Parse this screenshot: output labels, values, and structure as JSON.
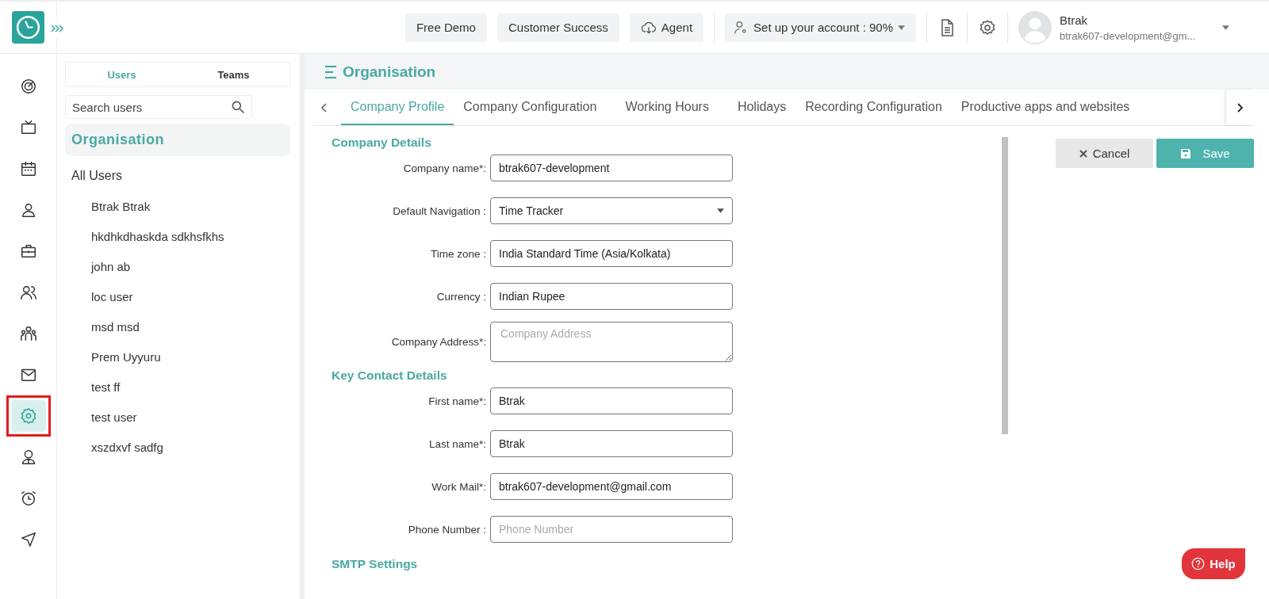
{
  "topbar": {
    "buttons": [
      {
        "label": "Free Demo",
        "kind": "plain"
      },
      {
        "label": "Customer Success",
        "kind": "plain"
      },
      {
        "label": "Agent",
        "kind": "download"
      }
    ],
    "setup": {
      "label": "Set up your account : 90%"
    },
    "user": {
      "name": "Btrak",
      "email": "btrak607-development@gm..."
    }
  },
  "rail": [
    {
      "kind": "target",
      "selected": false
    },
    {
      "kind": "tv",
      "selected": false
    },
    {
      "kind": "calendar",
      "selected": false
    },
    {
      "kind": "person",
      "selected": false
    },
    {
      "kind": "briefcase",
      "selected": false
    },
    {
      "kind": "people",
      "selected": false
    },
    {
      "kind": "group",
      "selected": false
    },
    {
      "kind": "mail",
      "selected": false
    },
    {
      "kind": "gear",
      "selected": true
    },
    {
      "kind": "badge",
      "selected": false
    },
    {
      "kind": "alarm",
      "selected": false
    },
    {
      "kind": "send",
      "selected": false
    }
  ],
  "users_panel": {
    "tabs": [
      {
        "label": "Users",
        "selected": true
      },
      {
        "label": "Teams",
        "selected": false
      }
    ],
    "search": {
      "placeholder": "Search users"
    },
    "tree": [
      {
        "label": "Organisation",
        "selected": true
      },
      {
        "label": "All Users",
        "selected": false,
        "children": [
          {
            "label": "Btrak Btrak",
            "selected": false
          },
          {
            "label": "hkdhkdhaskda sdkhsfkhs",
            "selected": false
          },
          {
            "label": "john ab",
            "selected": false
          },
          {
            "label": "loc user",
            "selected": false
          },
          {
            "label": "msd msd",
            "selected": false
          },
          {
            "label": "Prem Uyyuru",
            "selected": false
          },
          {
            "label": "test ff",
            "selected": false
          },
          {
            "label": "test user",
            "selected": false
          },
          {
            "label": "xszdxvf sadfg",
            "selected": false
          }
        ]
      }
    ]
  },
  "page": {
    "title": "Organisation",
    "tabs": [
      {
        "label": "Company Profile",
        "selected": true
      },
      {
        "label": "Company Configuration",
        "selected": false
      },
      {
        "label": "Working Hours",
        "selected": false
      },
      {
        "label": "Holidays",
        "selected": false
      },
      {
        "label": "Recording Configuration",
        "selected": false
      },
      {
        "label": "Productive apps and websites",
        "selected": false
      }
    ],
    "sections": [
      {
        "heading": "Company Details",
        "fields": [
          {
            "kind": "text",
            "label": "Company name*:",
            "value": "btrak607-development"
          },
          {
            "kind": "select",
            "label": "Default Navigation :",
            "value": "Time Tracker"
          },
          {
            "kind": "text",
            "label": "Time zone :",
            "value": "India Standard Time (Asia/Kolkata)"
          },
          {
            "kind": "text",
            "label": "Currency :",
            "value": "Indian Rupee"
          },
          {
            "kind": "textarea",
            "label": "Company Address*:",
            "placeholder": "Company Address"
          }
        ]
      },
      {
        "heading": "Key Contact Details",
        "fields": [
          {
            "kind": "text",
            "label": "First name*:",
            "value": "Btrak"
          },
          {
            "kind": "text",
            "label": "Last name*:",
            "value": "Btrak"
          },
          {
            "kind": "text",
            "label": "Work Mail*:",
            "value": "btrak607-development@gmail.com"
          },
          {
            "kind": "text",
            "label": "Phone Number :",
            "placeholder": "Phone Number"
          }
        ]
      },
      {
        "heading": "SMTP Settings"
      }
    ],
    "actions": [
      {
        "kind": "cancel",
        "label": "Cancel"
      },
      {
        "kind": "save",
        "label": "Save"
      }
    ]
  },
  "help": {
    "label": "Help"
  }
}
